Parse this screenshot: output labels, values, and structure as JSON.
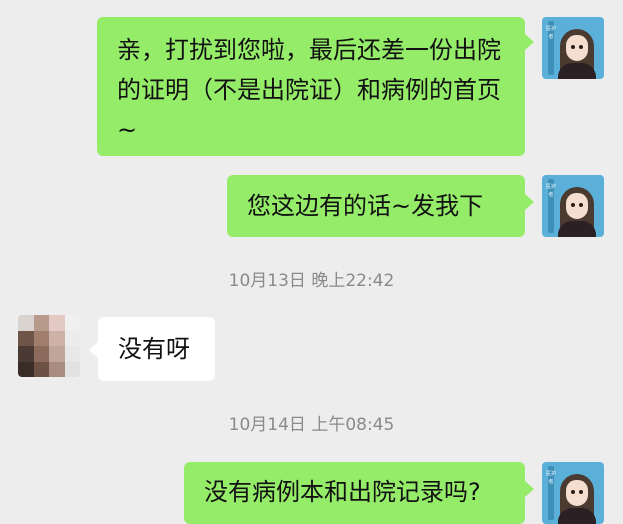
{
  "messages": [
    {
      "text": "亲，打扰到您啦，最后还差一份出院的证明（不是出院证）和病例的首页~"
    },
    {
      "text": "您这边有的话~发我下"
    },
    {
      "text": "没有呀"
    },
    {
      "text": "没有病例本和出院记录吗?"
    }
  ],
  "timestamps": [
    {
      "label": "10月13日 晚上22:42"
    },
    {
      "label": "10月14日 上午08:45"
    }
  ],
  "avatar_me": {
    "stripe_text": "医护者"
  },
  "colors": {
    "background": "#ededed",
    "outgoing_bubble": "#95ec69",
    "incoming_bubble": "#ffffff",
    "timestamp_text": "#8a8a8a"
  }
}
